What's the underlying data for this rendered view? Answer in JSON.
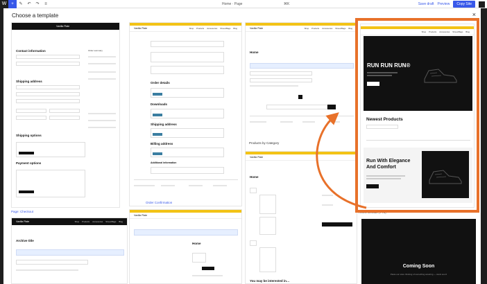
{
  "toolbar": {
    "center_label": "Home · Page",
    "center_shortcut": "⌘K",
    "save_draft": "Save draft",
    "preview": "Preview",
    "publish": "Copy Site"
  },
  "modal": {
    "title": "Choose a template",
    "close_symbol": "×"
  },
  "templates": {
    "page_checkout": {
      "caption": "Page: Checkout",
      "logo": "Vanilla Plate",
      "contact": "Contact information",
      "shipping": "Shipping address",
      "shipping_options": "Shipping options",
      "payment": "Payment options",
      "order_summary": "Order summary"
    },
    "archive": {
      "logo": "Vanilla Plate",
      "title": "Archive title"
    },
    "order_confirmation": {
      "caption": "Order Confirmation",
      "logo": "Vanilla Plate",
      "order_details": "Order details",
      "downloads": "Downloads",
      "shipping_address": "Shipping address",
      "billing_address": "Billing address",
      "additional": "Additional information"
    },
    "home_page": {
      "logo": "Vanilla Plate",
      "home": "Home",
      "caption_products": "Products by Category"
    },
    "products_cat": {
      "logo": "Vanilla Plate",
      "home": "Home",
      "interest": "You may be interested in…"
    },
    "home_default": {
      "caption": "Home Default (TT5)",
      "hero_title": "RUN RUN RUN®",
      "newest": "Newest Products",
      "run_title": "Run With Elegance And Comfort",
      "shop_now": "Shop now"
    },
    "coming_soon": {
      "title": "Coming Soon",
      "sub": "Paste our store thinking of something amazing — stock soon!"
    }
  },
  "nav_items": [
    "Shop",
    "Products",
    "Accessories",
    "Shoes/Bags",
    "Blog"
  ],
  "colors": {
    "accent": "#3858e9",
    "highlight": "#e8712a",
    "banner": "#f3c316",
    "dark": "#111111"
  },
  "icons": [
    "wordpress-icon",
    "plus-icon",
    "pencil-icon",
    "undo-icon",
    "redo-icon",
    "list-view-icon",
    "close-icon",
    "shoe-icon",
    "arrow-icon"
  ]
}
